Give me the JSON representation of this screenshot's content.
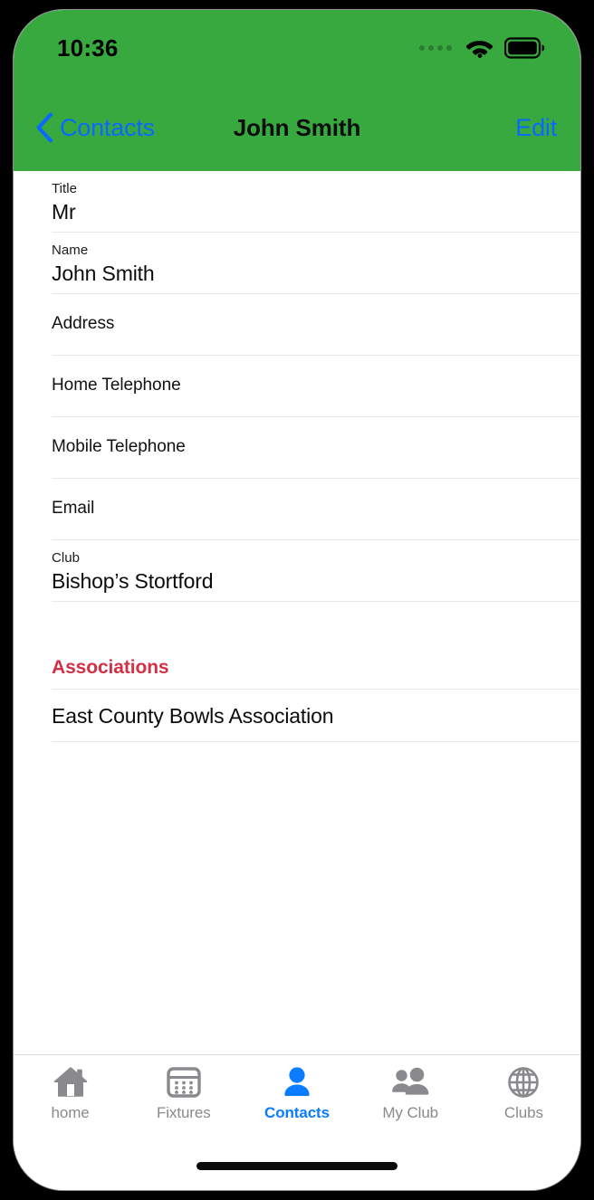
{
  "theme": {
    "brand_green": "#38a93e",
    "link_blue": "#0a69ff",
    "tab_active_blue": "#0a7cff",
    "tab_inactive_gray": "#8a8a8e",
    "association_red": "#d32f45",
    "separator_gray": "#e9e9e9"
  },
  "status_bar": {
    "time": "10:36",
    "signal_icon": "cellular-dots-icon",
    "wifi_icon": "wifi-icon",
    "battery_icon": "battery-full-icon"
  },
  "nav_bar": {
    "back_icon": "chevron-left-icon",
    "back_label": "Contacts",
    "title": "John Smith",
    "edit_label": "Edit"
  },
  "form": {
    "fields": [
      {
        "label": "Title",
        "value": "Mr"
      },
      {
        "label": "Name",
        "value": "John Smith"
      },
      {
        "label": "Address",
        "value": ""
      },
      {
        "label": "Home Telephone",
        "value": ""
      },
      {
        "label": "Mobile Telephone",
        "value": ""
      },
      {
        "label": "Email",
        "value": ""
      },
      {
        "label": "Club",
        "value": "Bishop’s Stortford"
      }
    ]
  },
  "associations": {
    "header": "Associations",
    "items": [
      {
        "name": "East County Bowls Association"
      }
    ]
  },
  "tab_bar": {
    "tabs": [
      {
        "label": "home",
        "icon": "house-icon",
        "active": false
      },
      {
        "label": "Fixtures",
        "icon": "calendar-icon",
        "active": false
      },
      {
        "label": "Contacts",
        "icon": "person-icon",
        "active": true
      },
      {
        "label": "My Club",
        "icon": "people-icon",
        "active": false
      },
      {
        "label": "Clubs",
        "icon": "globe-icon",
        "active": false
      }
    ]
  }
}
